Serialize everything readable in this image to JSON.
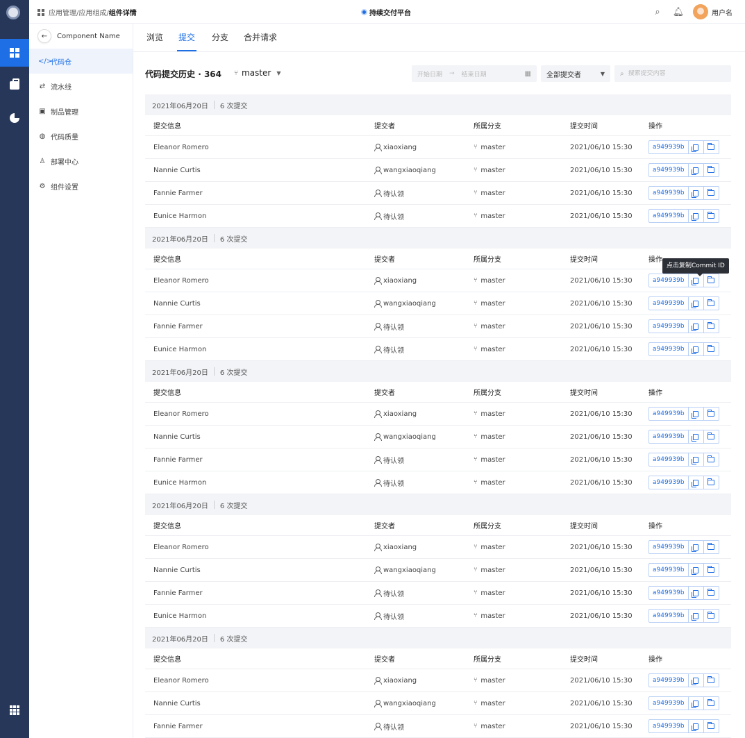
{
  "rail": {
    "items": [
      {
        "name": "apps-icon"
      },
      {
        "name": "briefcase-icon"
      },
      {
        "name": "pie-chart-icon"
      }
    ],
    "bottom_icon": "grid-menu-icon"
  },
  "header": {
    "breadcrumb": [
      "应用管理/",
      "应用组成/ ",
      "组件详情"
    ],
    "platform_name": "持续交付平台",
    "username": "用户名"
  },
  "sidebar": {
    "component_name": "Component Name",
    "items": [
      {
        "icon": "</>",
        "label": "代码仓",
        "active": true
      },
      {
        "icon": "⇄",
        "label": "流水线",
        "active": false
      },
      {
        "icon": "▣",
        "label": "制品管理",
        "active": false
      },
      {
        "icon": "◍",
        "label": "代码质量",
        "active": false
      },
      {
        "icon": "♙",
        "label": "部署中心",
        "active": false
      },
      {
        "icon": "⚙",
        "label": "组件设置",
        "active": false
      }
    ]
  },
  "tabs": [
    {
      "label": "浏览",
      "active": false
    },
    {
      "label": "提交",
      "active": true
    },
    {
      "label": "分支",
      "active": false
    },
    {
      "label": "合并请求",
      "active": false
    }
  ],
  "filters": {
    "history_title": "代码提交历史",
    "history_count": "364",
    "branch": "master",
    "start_placeholder": "开始日期",
    "end_placeholder": "结束日期",
    "committer": "全部提交者",
    "search_placeholder": "搜索提交内容"
  },
  "columns": {
    "message": "提交信息",
    "author": "提交者",
    "branch": "所属分支",
    "time": "提交时间",
    "actions": "操作"
  },
  "groups": [
    {
      "date": "2021年06月20日",
      "count": "6 次提交",
      "rows": [
        {
          "message": "Eleanor Romero",
          "author": "xiaoxiang",
          "branch": "master",
          "time": "2021/06/10 15:30",
          "hash": "a949939b"
        },
        {
          "message": "Nannie Curtis",
          "author": "wangxiaoqiang",
          "branch": "master",
          "time": "2021/06/10 15:30",
          "hash": "a949939b"
        },
        {
          "message": "Fannie Farmer",
          "author": "待认领",
          "branch": "master",
          "time": "2021/06/10 15:30",
          "hash": "a949939b"
        },
        {
          "message": "Eunice Harmon",
          "author": "待认领",
          "branch": "master",
          "time": "2021/06/10 15:30",
          "hash": "a949939b"
        }
      ]
    },
    {
      "date": "2021年06月20日",
      "count": "6 次提交",
      "rows": [
        {
          "message": "Eleanor Romero",
          "author": "xiaoxiang",
          "branch": "master",
          "time": "2021/06/10 15:30",
          "hash": "a949939b"
        },
        {
          "message": "Nannie Curtis",
          "author": "wangxiaoqiang",
          "branch": "master",
          "time": "2021/06/10 15:30",
          "hash": "a949939b"
        },
        {
          "message": "Fannie Farmer",
          "author": "待认领",
          "branch": "master",
          "time": "2021/06/10 15:30",
          "hash": "a949939b"
        },
        {
          "message": "Eunice Harmon",
          "author": "待认领",
          "branch": "master",
          "time": "2021/06/10 15:30",
          "hash": "a949939b"
        }
      ]
    },
    {
      "date": "2021年06月20日",
      "count": "6 次提交",
      "rows": [
        {
          "message": "Eleanor Romero",
          "author": "xiaoxiang",
          "branch": "master",
          "time": "2021/06/10 15:30",
          "hash": "a949939b"
        },
        {
          "message": "Nannie Curtis",
          "author": "wangxiaoqiang",
          "branch": "master",
          "time": "2021/06/10 15:30",
          "hash": "a949939b"
        },
        {
          "message": "Fannie Farmer",
          "author": "待认领",
          "branch": "master",
          "time": "2021/06/10 15:30",
          "hash": "a949939b"
        },
        {
          "message": "Eunice Harmon",
          "author": "待认领",
          "branch": "master",
          "time": "2021/06/10 15:30",
          "hash": "a949939b"
        }
      ]
    },
    {
      "date": "2021年06月20日",
      "count": "6 次提交",
      "rows": [
        {
          "message": "Eleanor Romero",
          "author": "xiaoxiang",
          "branch": "master",
          "time": "2021/06/10 15:30",
          "hash": "a949939b"
        },
        {
          "message": "Nannie Curtis",
          "author": "wangxiaoqiang",
          "branch": "master",
          "time": "2021/06/10 15:30",
          "hash": "a949939b"
        },
        {
          "message": "Fannie Farmer",
          "author": "待认领",
          "branch": "master",
          "time": "2021/06/10 15:30",
          "hash": "a949939b"
        },
        {
          "message": "Eunice Harmon",
          "author": "待认领",
          "branch": "master",
          "time": "2021/06/10 15:30",
          "hash": "a949939b"
        }
      ]
    },
    {
      "date": "2021年06月20日",
      "count": "6 次提交",
      "rows": [
        {
          "message": "Eleanor Romero",
          "author": "xiaoxiang",
          "branch": "master",
          "time": "2021/06/10 15:30",
          "hash": "a949939b"
        },
        {
          "message": "Nannie Curtis",
          "author": "wangxiaoqiang",
          "branch": "master",
          "time": "2021/06/10 15:30",
          "hash": "a949939b"
        },
        {
          "message": "Fannie Farmer",
          "author": "待认领",
          "branch": "master",
          "time": "2021/06/10 15:30",
          "hash": "a949939b"
        }
      ]
    }
  ],
  "tooltip": "点击复制Commit ID",
  "colors": {
    "rail_bg": "#27375a",
    "accent": "#1e6fe6"
  }
}
